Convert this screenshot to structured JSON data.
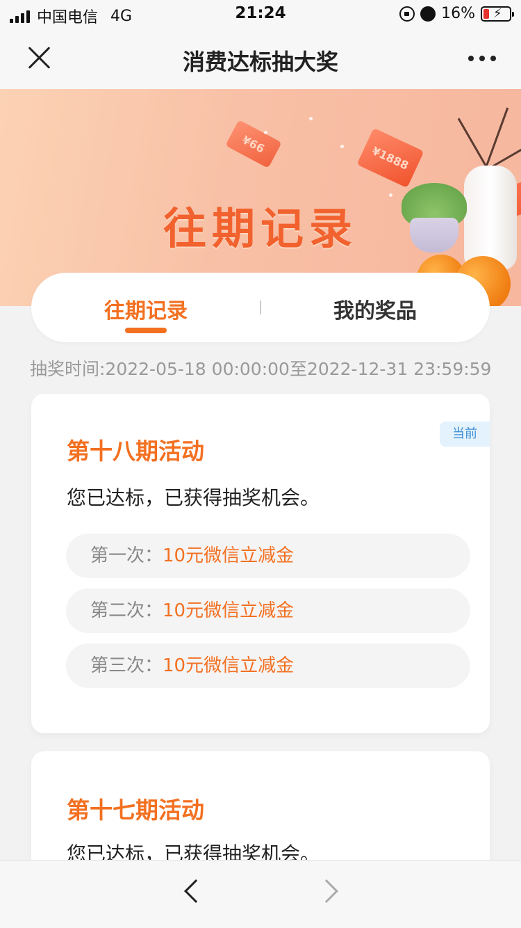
{
  "status_bar": {
    "carrier": "中国电信",
    "network": "4G",
    "time": "21:24",
    "battery": "16%"
  },
  "nav": {
    "title": "消费达标抽大奖"
  },
  "banner": {
    "title": "往期记录",
    "tickets": [
      "¥66",
      "¥1888",
      "¥"
    ]
  },
  "tabs": [
    {
      "label": "往期记录",
      "active": true
    },
    {
      "label": "我的奖品",
      "active": false
    }
  ],
  "draw_time": "抽奖时间:2022-05-18 00:00:00至2022-12-31 23:59:59",
  "activities": [
    {
      "title": "第十八期活动",
      "badge": "当前",
      "desc": "您已达标，已获得抽奖机会。",
      "draws": [
        {
          "label": "第一次：",
          "prize": "10元微信立减金"
        },
        {
          "label": "第二次：",
          "prize": "10元微信立减金"
        },
        {
          "label": "第三次：",
          "prize": "10元微信立减金"
        }
      ]
    },
    {
      "title": "第十七期活动",
      "desc": "您已达标，已获得抽奖机会。"
    }
  ],
  "colors": {
    "accent": "#f37021",
    "badge_bg": "#e3f2fd",
    "badge_text": "#3f8fd6"
  }
}
